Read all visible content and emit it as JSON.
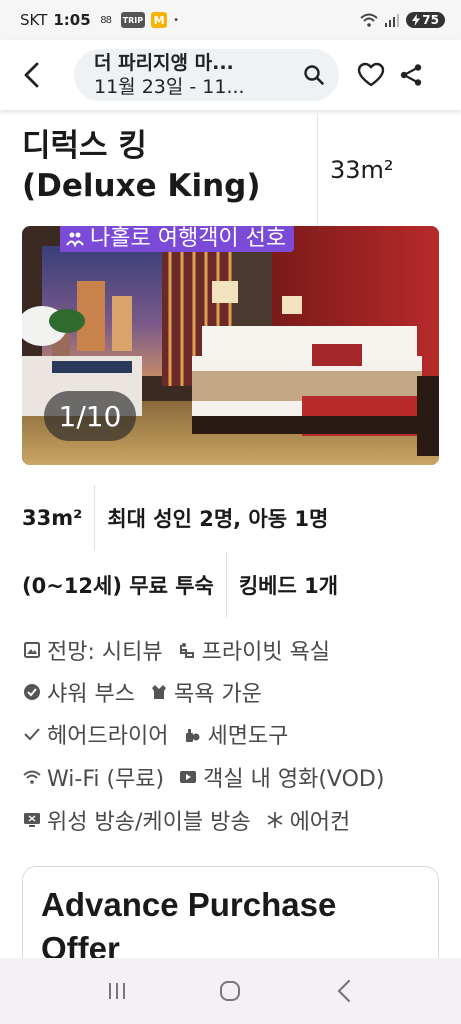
{
  "status_bar": {
    "carrier": "SKT",
    "time": "1:05",
    "icon_88": "88",
    "icon_trip": "TRIP",
    "icon_m": "M",
    "dot": "•",
    "battery": "75"
  },
  "header": {
    "search_title": "더 파리지앵 마...",
    "search_dates": "11월 23일 - 11..."
  },
  "room": {
    "name_line1": "디럭스 킹",
    "name_line2": "(Deluxe King)",
    "size": "33m²"
  },
  "photo": {
    "badge": "나홀로 여행객이 선호",
    "counter": "1/10"
  },
  "details": {
    "size": "33m²",
    "occupancy": "최대 성인 2명, 아동 1명",
    "child_policy": "(0~12세) 무료 투숙",
    "bed": "킹베드 1개"
  },
  "amenities": [
    {
      "label": "전망: 시티뷰",
      "icon": "view-icon"
    },
    {
      "label": "프라이빗 욕실",
      "icon": "bath-icon"
    },
    {
      "label": "샤워 부스",
      "icon": "check-circle-icon"
    },
    {
      "label": "목욕 가운",
      "icon": "robe-icon"
    },
    {
      "label": "헤어드라이어",
      "icon": "check-icon"
    },
    {
      "label": "세면도구",
      "icon": "toiletries-icon"
    },
    {
      "label": "Wi-Fi (무료)",
      "icon": "wifi-icon"
    },
    {
      "label": "객실 내 영화(VOD)",
      "icon": "play-icon"
    },
    {
      "label": "위성 방송/케이블 방송",
      "icon": "tv-icon"
    },
    {
      "label": "에어컨",
      "icon": "snowflake-icon"
    }
  ],
  "offer": {
    "title": "Advance Purchase Offer"
  },
  "colors": {
    "badge": "#7b4bd8",
    "search_bg": "#eef2f5",
    "nav_bg": "#f5f0f5"
  }
}
